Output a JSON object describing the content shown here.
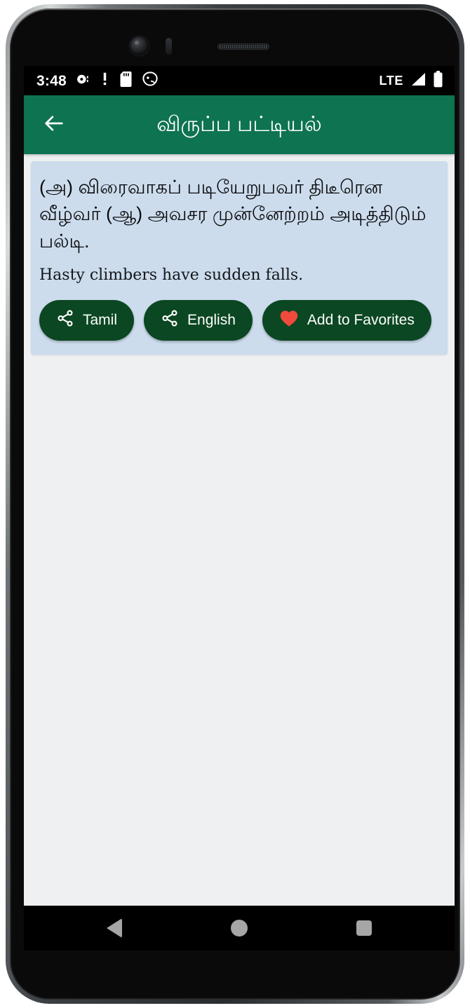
{
  "status_bar": {
    "clock": "3:48",
    "network_label": "LTE",
    "left_icons": [
      "disc-icon",
      "exclamation-icon",
      "sd-card-icon",
      "android-head-icon"
    ],
    "right_icons": [
      "signal-bars-icon",
      "battery-full-icon"
    ],
    "background_color": "#000000"
  },
  "app_bar": {
    "title": "விருப்ப பட்டியல்",
    "back_icon": "arrow-left-icon",
    "background_color": "#0e7350",
    "text_color": "#ffffff"
  },
  "card": {
    "background_color": "#ccdced",
    "tamil_text": "(அ) விரைவாகப் படியேறுபவர் திடீரென வீழ்வர் (ஆ) அவசர முன்னேற்றம் அடித்திடும் பல்டி.",
    "english_text": "Hasty climbers have sudden falls.",
    "buttons": [
      {
        "label": "Tamil",
        "icon": "share-icon",
        "color": "#0b4722"
      },
      {
        "label": "English",
        "icon": "share-icon",
        "color": "#0b4722"
      },
      {
        "label": "Add to Favorites",
        "icon": "heart-icon",
        "color": "#0b4722",
        "icon_color": "#ef4a3c"
      }
    ]
  },
  "page": {
    "background_color": "#eff0f1"
  },
  "nav_bar": {
    "items": [
      {
        "name": "back",
        "icon": "triangle-left-icon"
      },
      {
        "name": "home",
        "icon": "circle-icon"
      },
      {
        "name": "recents",
        "icon": "square-icon"
      }
    ],
    "background_color": "#000000",
    "icon_color": "#a6a6a6"
  }
}
